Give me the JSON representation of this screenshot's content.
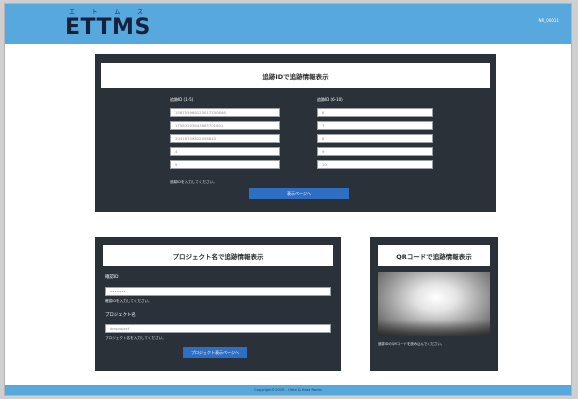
{
  "header": {
    "logo_ruby": [
      "エ",
      "ト",
      "ム",
      "ス"
    ],
    "logo": "ETTMS",
    "user_id": "NR_00011"
  },
  "trace_panel": {
    "title": "追跡IDで追跡情報表示",
    "left_label": "追跡ID (1-5)",
    "right_label": "追跡ID (6-10)",
    "left_fields": [
      "158755968123017700846",
      "17583203643665701601",
      "20478709822058840",
      "4",
      "5"
    ],
    "right_fields": [
      "6",
      "7",
      "8",
      "9",
      "10"
    ],
    "hint": "追跡IDを入力してください。",
    "button": "表示ページへ"
  },
  "project_panel": {
    "title": "プロジェクト名で追跡情報表示",
    "id_label": "確認ID",
    "id_value": "•••••••",
    "id_hint": "確認IDを入力してください。",
    "name_label": "プロジェクト名",
    "name_value": "dmproject",
    "name_hint": "プロジェクト名を入力してください。",
    "button": "プロジェクト表示ページへ"
  },
  "qr_panel": {
    "title": "QRコードで追跡情報表示",
    "hint": "追跡IDのQRコードを読み込んでください。"
  },
  "footer": {
    "copyright": "Copyright©2020 - Ohta & Hata Rocks"
  }
}
